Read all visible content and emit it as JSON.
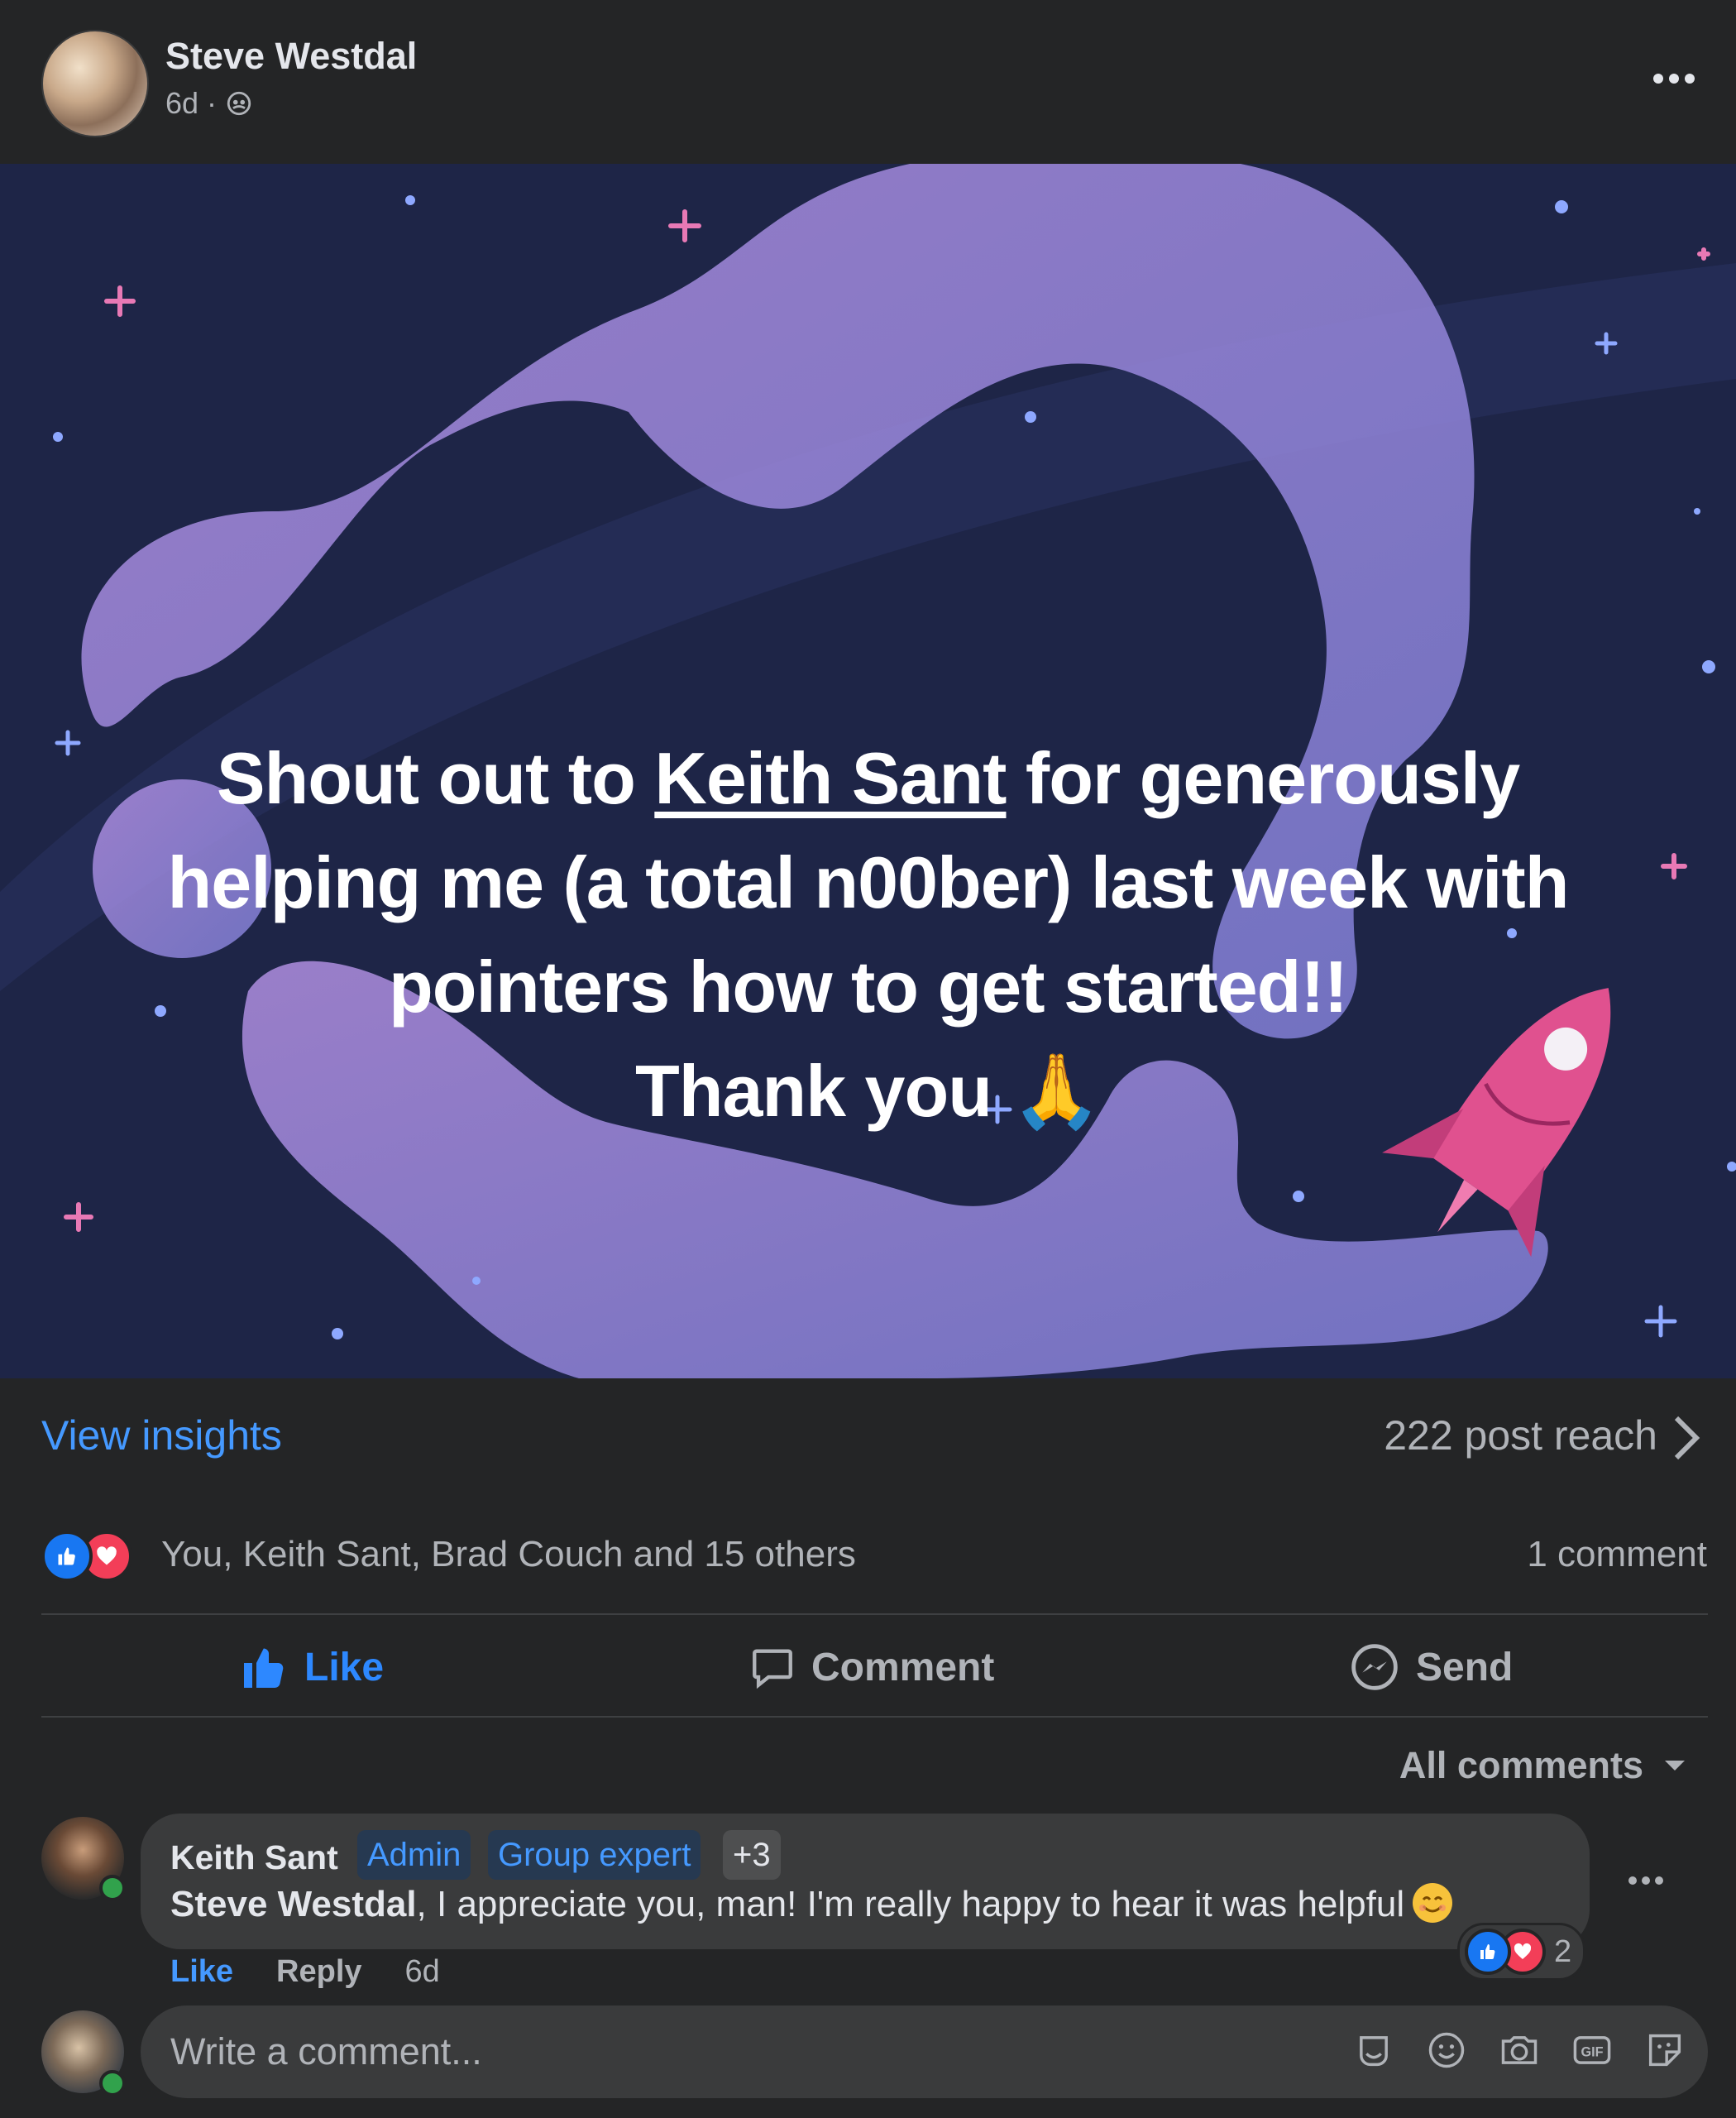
{
  "post": {
    "author": "Steve Westdal",
    "time": "6d",
    "separator": "·",
    "banner": {
      "line1_pre": "Shout out to ",
      "line1_mention": "Keith Sant",
      "line1_post": " for generously",
      "line2": "helping me (a total n00ber) last week with",
      "line3": "pointers how to get started!!",
      "line4": "Thank you",
      "emoji": "🙏"
    }
  },
  "insights": {
    "link": "View insights",
    "reach": "222 post reach"
  },
  "reactions": {
    "names": "You, Keith Sant, Brad Couch and 15 others",
    "comment_count": "1 comment"
  },
  "actions": {
    "like": "Like",
    "comment": "Comment",
    "send": "Send"
  },
  "comments_filter": "All comments",
  "comment": {
    "author": "Keith Sant",
    "badges": [
      "Admin",
      "Group expert",
      "+3"
    ],
    "tag": "Steve Westdal",
    "text": ", I appreciate you, man! I'm really happy to hear it was helpful",
    "reaction_count": "2",
    "like": "Like",
    "reply": "Reply",
    "time": "6d"
  },
  "composer": {
    "placeholder": "Write a comment..."
  },
  "icons": [
    "globe-icon",
    "more-icon",
    "chevron-right-icon",
    "like-reaction-icon",
    "love-reaction-icon",
    "thumbs-up-icon",
    "comment-icon",
    "messenger-icon",
    "caret-down-icon",
    "avatar-sticker-icon",
    "emoji-icon",
    "camera-icon",
    "gif-icon",
    "sticker-icon"
  ],
  "colors": {
    "background": "#242526",
    "accent": "#4599ff",
    "banner_bg": "#1e2547",
    "banner_shape": "#9a86d9",
    "love": "#f33e58"
  }
}
